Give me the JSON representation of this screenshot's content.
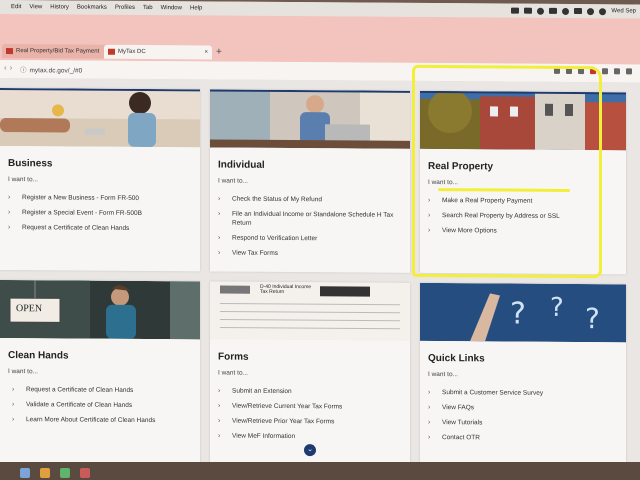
{
  "menubar": {
    "items": [
      "Edit",
      "View",
      "History",
      "Bookmarks",
      "Profiles",
      "Tab",
      "Window",
      "Help"
    ],
    "clock": "Wed Sep"
  },
  "tabs": [
    {
      "label": "Real Property/Bid Tax Payment"
    },
    {
      "label": "MyTax DC"
    }
  ],
  "address": {
    "url": "mytax.dc.gov/_/#0"
  },
  "cards": {
    "business": {
      "title": "Business",
      "want": "I want to...",
      "links": [
        "Register a New Business - Form FR-500",
        "Register a Special Event - Form FR-500B",
        "Request a Certificate of Clean Hands"
      ]
    },
    "individual": {
      "title": "Individual",
      "want": "I want to...",
      "links": [
        "Check the Status of My Refund",
        "File an Individual Income or Standalone Schedule H Tax Return",
        "Respond to Verification Letter",
        "View Tax Forms"
      ]
    },
    "realproperty": {
      "title": "Real Property",
      "want": "I want to...",
      "links": [
        "Make a Real Property Payment",
        "Search Real Property by Address or SSL",
        "View More Options"
      ]
    },
    "cleanhands": {
      "title": "Clean Hands",
      "want": "I want to...",
      "sign": "OPEN",
      "links": [
        "Request a Certificate of Clean Hands",
        "Validate a Certificate of Clean Hands",
        "Learn More About Certificate of Clean Hands"
      ]
    },
    "forms": {
      "title": "Forms",
      "want": "I want to...",
      "form_title": "D-40  Individual Income Tax Return",
      "links": [
        "Submit an Extension",
        "View/Retrieve Current Year Tax Forms",
        "View/Retrieve Prior Year Tax Forms",
        "View MeF Information"
      ]
    },
    "quicklinks": {
      "title": "Quick Links",
      "want": "I want to...",
      "links": [
        "Submit a Customer Service Survey",
        "View FAQs",
        "View Tutorials",
        "Contact OTR"
      ]
    }
  },
  "colors": {
    "accent": "#1f3a6f",
    "highlight": "#f3ee3a",
    "tabbar": "#f2c4bd"
  }
}
